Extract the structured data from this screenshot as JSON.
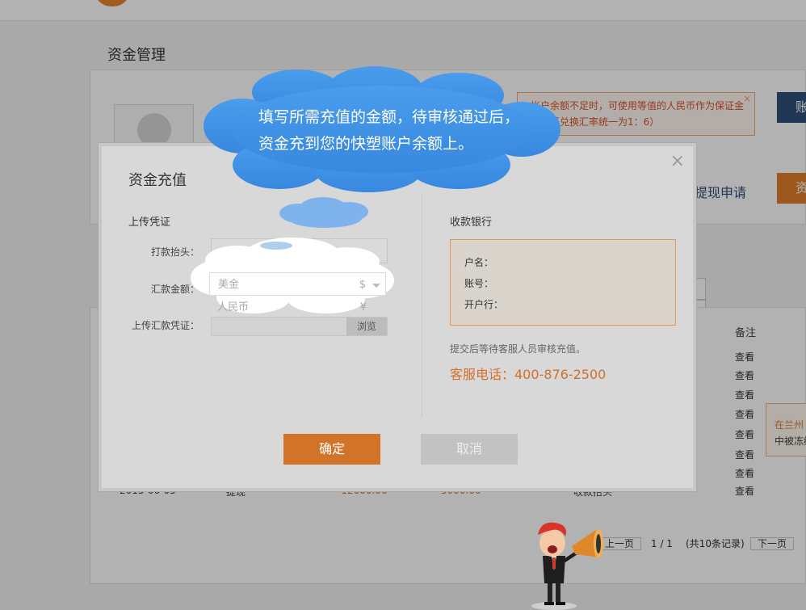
{
  "page": {
    "title": "资金管理"
  },
  "background": {
    "notice": [
      "帐户余额不足时，可使用等值的人民币作为保证金",
      "人民币兑换汇率统一为1：6）"
    ],
    "notice_close": "×",
    "blue_button": "账",
    "orange_button": "资",
    "withdraw_link": "提现申请",
    "col_remarks": "备注",
    "view_links": [
      "查看",
      "查看",
      "查看",
      "查看",
      "查看",
      "查看",
      "查看",
      "查看"
    ],
    "row": {
      "date": "2015-06-05",
      "type": "提现",
      "amount": "-12000.00",
      "balance": "5000.00",
      "note": "收款抬头"
    },
    "tip": [
      "在兰州",
      "中被冻结"
    ],
    "pager": {
      "prev": "上一页",
      "pages": "1 / 1",
      "total": "(共10条记录)",
      "next": "下一页"
    }
  },
  "modal": {
    "title": "资金充值",
    "close": "×",
    "upload_section": "上传凭证",
    "payee_section": "收款银行",
    "fields": {
      "payer_label": "打款抬头：",
      "amount_label": "汇款金额：",
      "voucher_label": "上传汇款凭证：",
      "browse": "浏览"
    },
    "currency_options": [
      {
        "name": "美金",
        "symbol": "$"
      },
      {
        "name": "人民币",
        "symbol": "¥"
      }
    ],
    "bank": {
      "account_name": "户名：",
      "account_no": "账号：",
      "bank_branch": "开户行："
    },
    "hint": "提交后等待客服人员审核充值。",
    "phone": "客服电话：400-876-2500",
    "confirm": "确定",
    "cancel": "取消"
  },
  "callout": {
    "lines": [
      "填写所需充值的金额，待审核通过后，",
      "资金充到您的快塑账户余额上。"
    ]
  },
  "colors": {
    "accent_orange": "#d2732a",
    "navy": "#2f4f7c",
    "cloud_blue": "#3d8fe0"
  }
}
